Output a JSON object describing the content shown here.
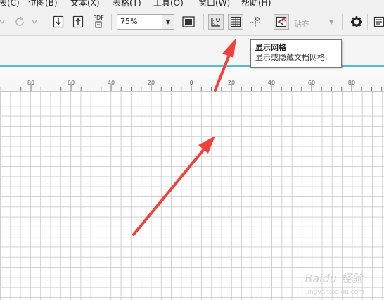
{
  "menu": {
    "items": [
      "表(C)",
      "位图(B)",
      "文本(X)",
      "表格(T)",
      "工具(O)",
      "窗口(W)",
      "帮助(H)"
    ]
  },
  "toolbar": {
    "pdf_label": "PDF",
    "zoom_value": "75%",
    "snap_label": "贴齐"
  },
  "tooltip": {
    "title": "显示网格",
    "description": "显示或隐藏文档网格."
  },
  "ruler": {
    "labels": [
      "80",
      "60",
      "40",
      "20",
      "0",
      "20",
      "40",
      "60",
      "80"
    ]
  },
  "watermark": {
    "text": "Baidu 经验",
    "sub": "jingyan.baidu.com"
  },
  "colors": {
    "arrow": "#f2413a",
    "accent_line": "#5fb7c9"
  }
}
